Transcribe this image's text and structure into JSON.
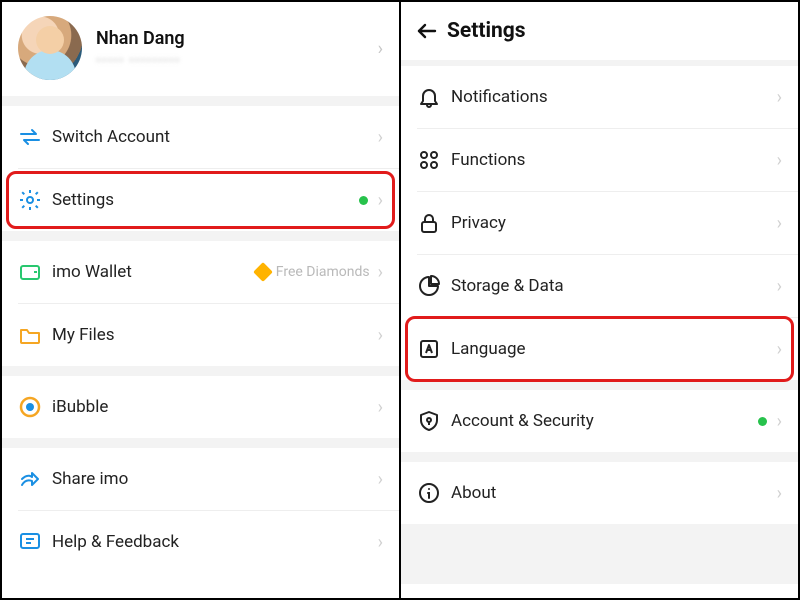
{
  "left": {
    "profile": {
      "name": "Nhan Dang",
      "subtitle": "••••• •••••••••"
    },
    "items": [
      {
        "label": "Switch Account"
      },
      {
        "label": "Settings"
      },
      {
        "label": "imo Wallet",
        "aux": "Free Diamonds"
      },
      {
        "label": "My Files"
      },
      {
        "label": "iBubble"
      },
      {
        "label": "Share imo"
      },
      {
        "label": "Help & Feedback"
      }
    ]
  },
  "right": {
    "title": "Settings",
    "items": [
      {
        "label": "Notifications"
      },
      {
        "label": "Functions"
      },
      {
        "label": "Privacy"
      },
      {
        "label": "Storage & Data"
      },
      {
        "label": "Language"
      },
      {
        "label": "Account & Security"
      },
      {
        "label": "About"
      }
    ]
  }
}
